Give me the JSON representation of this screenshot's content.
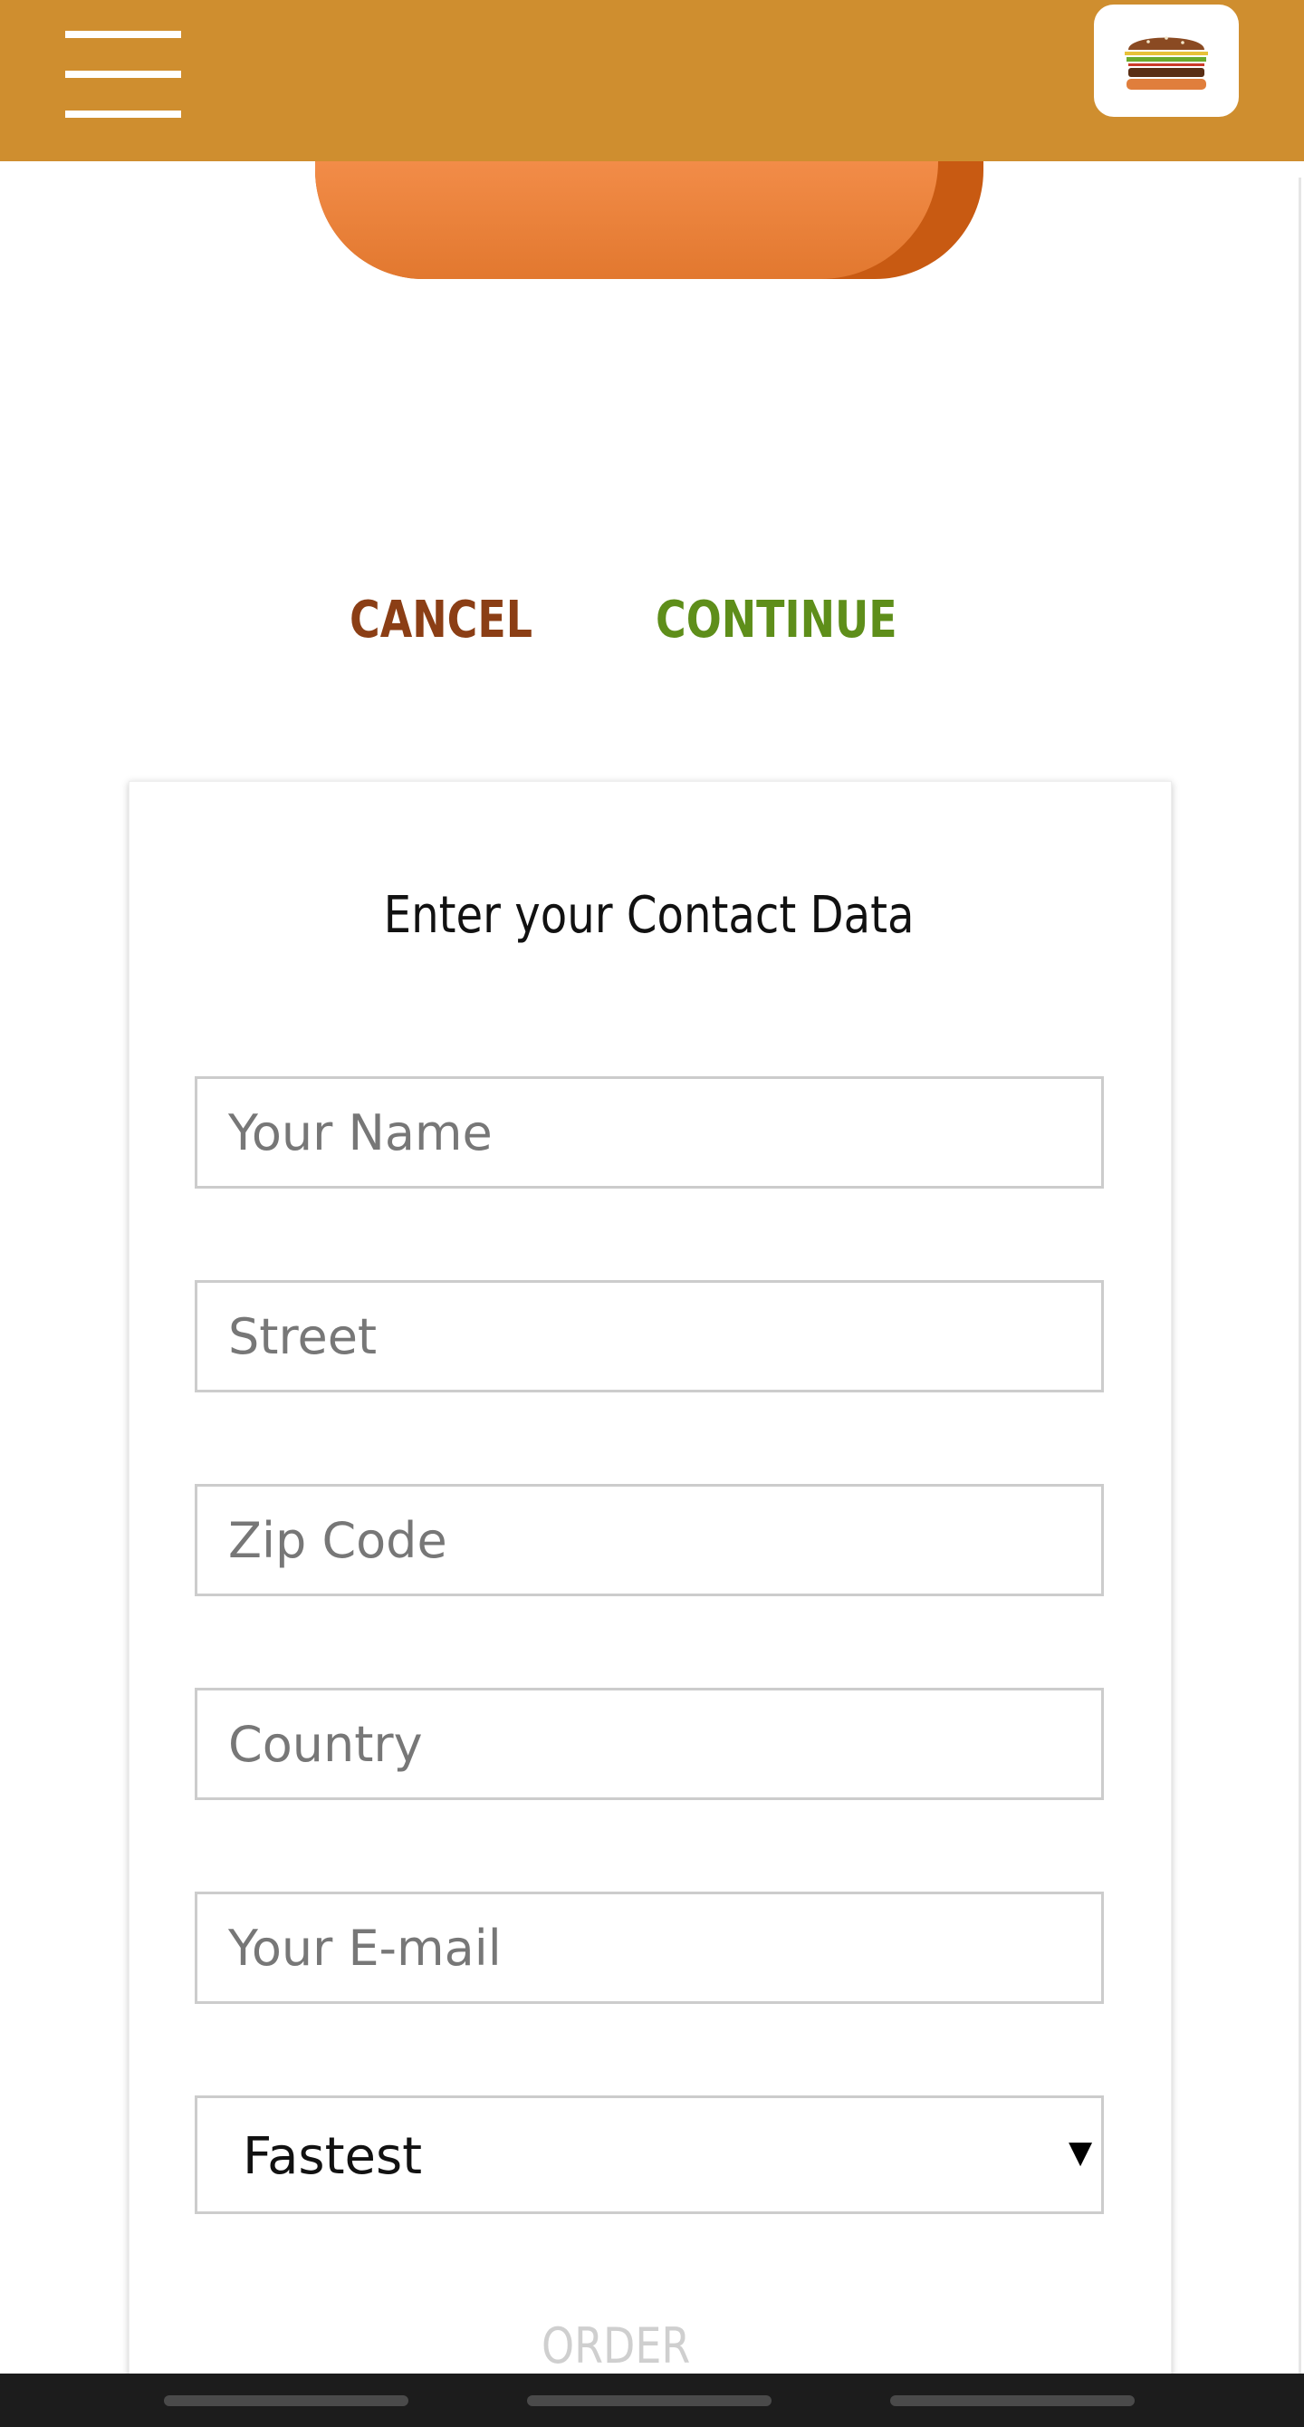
{
  "header": {
    "menu_icon": "hamburger-menu-icon",
    "logo_icon": "burger-logo-icon",
    "bar_color": "#CF8E2F"
  },
  "actions": {
    "cancel_label": "CANCEL",
    "continue_label": "CONTINUE",
    "cancel_color": "#8B3E15",
    "continue_color": "#5E8E1A"
  },
  "contact_form": {
    "title": "Enter your Contact Data",
    "fields": {
      "name": {
        "placeholder": "Your Name",
        "value": ""
      },
      "street": {
        "placeholder": "Street",
        "value": ""
      },
      "zip": {
        "placeholder": "Zip Code",
        "value": ""
      },
      "country": {
        "placeholder": "Country",
        "value": ""
      },
      "email": {
        "placeholder": "Your E-mail",
        "value": ""
      }
    },
    "delivery_method": {
      "selected": "Fastest"
    },
    "order_label": "ORDER"
  },
  "system_bar": {
    "tabs": 3
  }
}
